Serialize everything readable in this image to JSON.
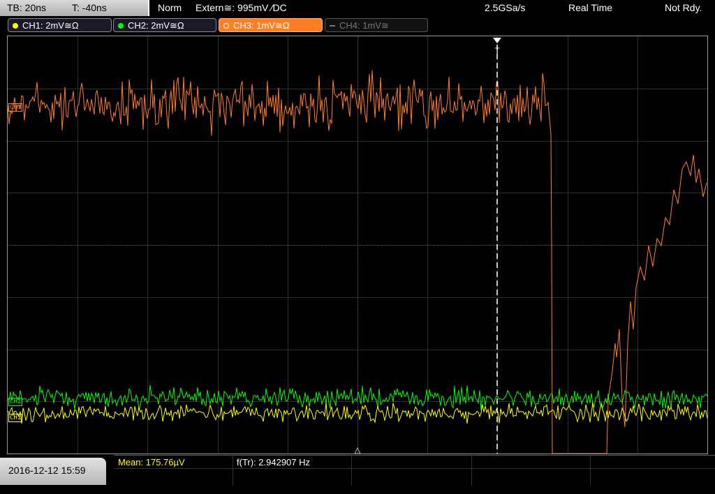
{
  "top_bar": {
    "timebase": "TB: 20ns",
    "trigger_time": "T: -40ns",
    "trigger_mode": "Norm",
    "trigger_source": "Extern≅: 995mV ⁄DC",
    "sample_rate": "2.5GSa/s",
    "acq_mode": "Real Time",
    "status": "Not Rdy."
  },
  "channels": [
    {
      "label": "CH1: 2mV≅Ω",
      "color": "#ffff00",
      "active": false
    },
    {
      "label": "CH2: 2mV≅Ω",
      "color": "#00ff00",
      "active": false
    },
    {
      "label": "CH3: 1mV≅Ω",
      "color": "#ff7f27",
      "active": true
    },
    {
      "label": "CH4: 1mV≅",
      "color": "#777777",
      "active": false
    }
  ],
  "trigger_marker": "T",
  "channel_markers": {
    "ch1": "CH1",
    "ch2": "CH2",
    "ch3": "CH3"
  },
  "footer": {
    "datetime": "2016-12-12 15:59",
    "mean": "Mean: 175.76µV",
    "frequency": "f(Tr): 2.942907 Hz"
  },
  "colors": {
    "ch1": "#ffff00",
    "ch2": "#00ff00",
    "ch3": "#ff7f27",
    "grid": "#3c3c3c",
    "trigger_line": "#ffffff"
  }
}
